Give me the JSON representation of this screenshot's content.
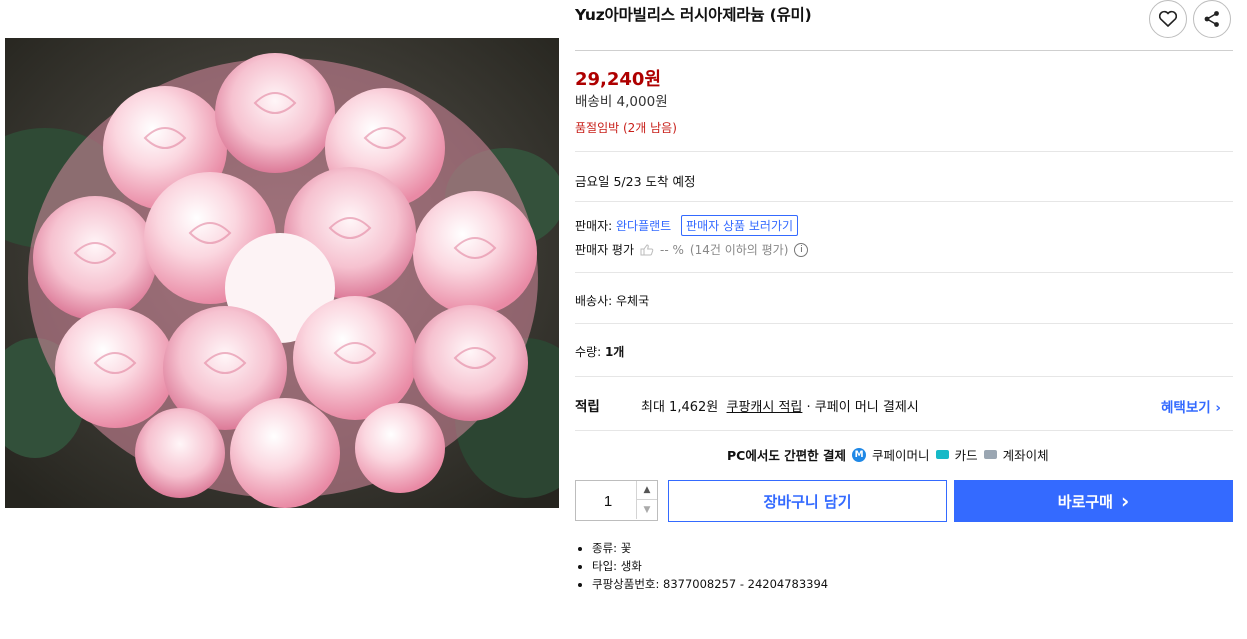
{
  "product": {
    "title": "Yuz아마빌리스 러시아제라늄 (유미)",
    "image_alt": "pink rosebud geranium flower photo"
  },
  "actions": {
    "wishlist_icon": "heart-icon",
    "share_icon": "share-icon"
  },
  "price": {
    "amount": "29,240원",
    "shipping": "배송비 4,000원",
    "stock_warning": "품절임박 (2개 남음)"
  },
  "delivery": {
    "arrival": "금요일 5/23 도착 예정"
  },
  "seller": {
    "label": "판매자:",
    "name": "완다플랜트",
    "store_button": "판매자 상품 보러가기",
    "rating_label": "판매자 평가",
    "rating_value": "-- %",
    "rating_note": "(14건 이하의 평가)"
  },
  "courier": {
    "label": "배송사:",
    "name": "우체국"
  },
  "quantity_info": {
    "label": "수량:",
    "value": "1개"
  },
  "reward": {
    "label": "적립",
    "prefix": "최대 1,462원",
    "link": "쿠팡캐시 적립",
    "suffix": "· 쿠페이 머니 결제시",
    "benefit_link": "혜택보기"
  },
  "payment": {
    "title": "PC에서도 간편한 결제",
    "coupay": "쿠페이머니",
    "coupay_badge": "M",
    "card": "카드",
    "bank": "계좌이체"
  },
  "purchase": {
    "quantity": "1",
    "cart_button": "장바구니 담기",
    "buy_button": "바로구매",
    "buy_arrow": "›"
  },
  "attributes": [
    "종류: 꽃",
    "타입: 생화",
    "쿠팡상품번호: 8377008257 - 24204783394"
  ],
  "colors": {
    "accent": "#346aff",
    "price": "#ae0000",
    "warning": "#c8211b"
  }
}
